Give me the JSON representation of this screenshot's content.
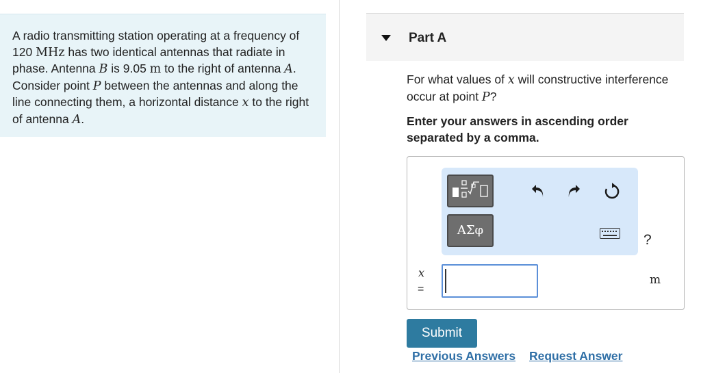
{
  "problem": {
    "text_1": "A radio transmitting station operating at a frequency of 120 ",
    "freq_unit": "MHz",
    "text_2": " has two identical antennas that radiate in phase. Antenna ",
    "antenna_b": "B",
    "text_3": " is 9.05 ",
    "dist_unit": "m",
    "text_4": " to the right of antenna ",
    "antenna_a1": "A",
    "text_5": ". Consider point ",
    "point_p": "P",
    "text_6": " between the antennas and along the line connecting them, a horizontal distance ",
    "var_x": "x",
    "text_7": " to the right of antenna ",
    "antenna_a2": "A",
    "text_8": "."
  },
  "part": {
    "title": "Part A",
    "toggle_icon": "caret-down-icon"
  },
  "question": {
    "text_1": "For what values of ",
    "var_x": "x",
    "text_2": " will constructive interference occur at point ",
    "point_p": "P",
    "text_3": "?"
  },
  "instruction": "Enter your answers in ascending order separated by a comma.",
  "answer": {
    "variable": "x",
    "equals": "=",
    "value": "",
    "unit": "m",
    "toolbar": {
      "templates_icon": "templates-icon",
      "symbols_label": "ΑΣφ",
      "undo_icon": "undo-icon",
      "redo_icon": "redo-icon",
      "reset_icon": "reset-icon",
      "keyboard_icon": "keyboard-icon",
      "help_label": "?"
    }
  },
  "buttons": {
    "submit": "Submit",
    "previous_answers": "Previous Answers",
    "request_answer": "Request Answer"
  },
  "colors": {
    "problem_bg": "#e8f4f8",
    "toolbar_bg": "#d7e8fa",
    "submit_bg": "#2e7ba0",
    "link": "#2f6fa6"
  }
}
